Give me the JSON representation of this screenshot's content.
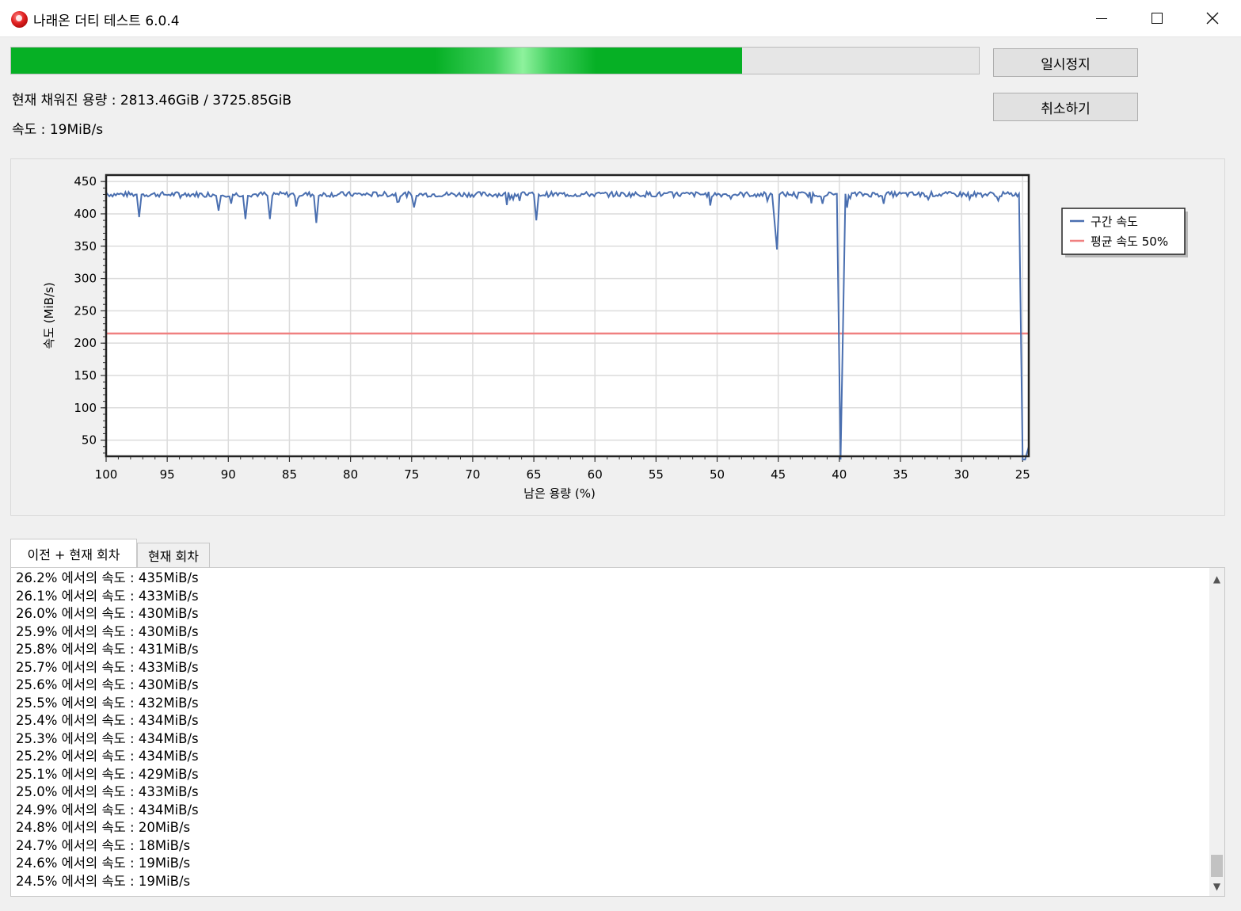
{
  "window": {
    "title": "나래온 더티 테스트 6.0.4",
    "minimize_icon": "minimize-icon",
    "maximize_icon": "maximize-icon",
    "close_icon": "close-icon"
  },
  "progress": {
    "filled_percent": 75.5,
    "fill_color": "#06b025"
  },
  "buttons": {
    "pause": "일시정지",
    "cancel": "취소하기"
  },
  "status": {
    "capacity_line": "현재 채워진 용량 : 2813.46GiB / 3725.85GiB",
    "speed_line": "속도 : 19MiB/s"
  },
  "chart_data": {
    "type": "line",
    "xlabel": "남은 용량 (%)",
    "ylabel": "속도 (MiB/s)",
    "xlim": [
      100,
      24.5
    ],
    "ylim": [
      25,
      460
    ],
    "x_ticks": [
      "100",
      "95",
      "90",
      "85",
      "80",
      "75",
      "70",
      "65",
      "60",
      "55",
      "50",
      "45",
      "40",
      "35",
      "30",
      "25"
    ],
    "y_ticks": [
      "450",
      "400",
      "350",
      "300",
      "250",
      "200",
      "150",
      "100",
      "50"
    ],
    "grid": true,
    "legend_position": "right",
    "series": [
      {
        "name": "구간 속도",
        "color": "#4a6fb0",
        "baseline": 431,
        "points": [
          [
            100,
            433
          ],
          [
            97.5,
            430
          ],
          [
            97.3,
            395
          ],
          [
            97.1,
            430
          ],
          [
            95,
            429
          ],
          [
            91,
            428
          ],
          [
            90.8,
            405
          ],
          [
            90.6,
            428
          ],
          [
            88.8,
            428
          ],
          [
            88.6,
            392
          ],
          [
            88.4,
            428
          ],
          [
            86.8,
            428
          ],
          [
            86.6,
            392
          ],
          [
            86.4,
            428
          ],
          [
            83,
            428
          ],
          [
            82.8,
            386
          ],
          [
            82.6,
            428
          ],
          [
            75,
            428
          ],
          [
            74.8,
            410
          ],
          [
            74.6,
            428
          ],
          [
            65,
            430
          ],
          [
            64.8,
            390
          ],
          [
            64.6,
            430
          ],
          [
            45.5,
            430
          ],
          [
            45.1,
            345
          ],
          [
            44.9,
            430
          ],
          [
            40.2,
            431
          ],
          [
            39.9,
            20
          ],
          [
            39.7,
            228
          ],
          [
            39.5,
            431
          ],
          [
            25.3,
            431
          ],
          [
            25,
            20
          ],
          [
            24.8,
            20
          ],
          [
            24.5,
            40
          ]
        ]
      },
      {
        "name": "평균 속도 50%",
        "color": "#f08080",
        "value": 215
      }
    ]
  },
  "tabs": [
    {
      "label": "이전 + 현재 회차"
    },
    {
      "label": "현재 회차"
    }
  ],
  "log": [
    "26.2% 에서의 속도 : 435MiB/s",
    "26.1% 에서의 속도 : 433MiB/s",
    "26.0% 에서의 속도 : 430MiB/s",
    "25.9% 에서의 속도 : 430MiB/s",
    "25.8% 에서의 속도 : 431MiB/s",
    "25.7% 에서의 속도 : 433MiB/s",
    "25.6% 에서의 속도 : 430MiB/s",
    "25.5% 에서의 속도 : 432MiB/s",
    "25.4% 에서의 속도 : 434MiB/s",
    "25.3% 에서의 속도 : 434MiB/s",
    "25.2% 에서의 속도 : 434MiB/s",
    "25.1% 에서의 속도 : 429MiB/s",
    "25.0% 에서의 속도 : 433MiB/s",
    "24.9% 에서의 속도 : 434MiB/s",
    "24.8% 에서의 속도 : 20MiB/s",
    "24.7% 에서의 속도 : 18MiB/s",
    "24.6% 에서의 속도 : 19MiB/s",
    "24.5% 에서의 속도 : 19MiB/s"
  ]
}
